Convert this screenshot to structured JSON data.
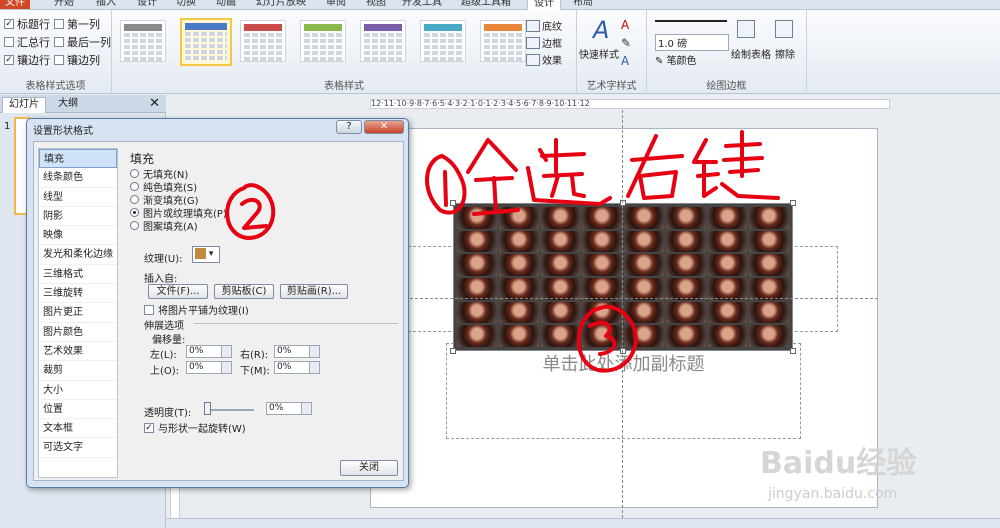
{
  "tabs": [
    "文件",
    "开始",
    "插入",
    "设计",
    "切换",
    "动画",
    "幻灯片放映",
    "审阅",
    "视图",
    "开发工具",
    "超级工具箱",
    "设计",
    "布局"
  ],
  "ribbon": {
    "style_options": {
      "items": [
        "标题行",
        "第一列",
        "汇总行",
        "最后一列",
        "镶边行",
        "镶边列"
      ],
      "checked": [
        true,
        false,
        false,
        false,
        true,
        false
      ],
      "label": "表格样式选项"
    },
    "table_styles": {
      "label": "表格样式",
      "swatch_colors": [
        "#8a8a8a",
        "#4a7bc4",
        "#c94b4b",
        "#8ab84a",
        "#7b5ea7",
        "#47a9c4",
        "#e8873a"
      ],
      "selected_index": 1
    },
    "shading": {
      "shading_label": "底纹",
      "border_label": "边框",
      "effects_label": "效果"
    },
    "art_text": {
      "quick_style_label": "快速样式",
      "group_label": "艺术字样式"
    },
    "draw_borders": {
      "weight": "1.0 磅",
      "pen_color_label": "笔颜色",
      "draw_table_label": "绘制表格",
      "eraser_label": "擦除",
      "group_label": "绘图边框"
    }
  },
  "left_panel": {
    "tab_slides": "幻灯片",
    "tab_outline": "大纲",
    "close": "✕",
    "slide_number": "1"
  },
  "ruler_text": "12·11·10·9·8·7·6·5·4·3·2·1·0·1·2·3·4·5·6·7·8·9·10·11·12",
  "vruler_text": "8",
  "slide": {
    "subtitle_placeholder": "单击此处添加副标题"
  },
  "dialog": {
    "title": "设置形状格式",
    "help_btn": "?",
    "close_btn": "✕",
    "categories": [
      "填充",
      "线条颜色",
      "线型",
      "阴影",
      "映像",
      "发光和柔化边缘",
      "三维格式",
      "三维旋转",
      "图片更正",
      "图片颜色",
      "艺术效果",
      "裁剪",
      "大小",
      "位置",
      "文本框",
      "可选文字"
    ],
    "selected_category": 0,
    "heading": "填充",
    "fill_options": [
      "无填充(N)",
      "纯色填充(S)",
      "渐变填充(G)",
      "图片或纹理填充(P)",
      "图案填充(A)"
    ],
    "selected_fill": 3,
    "texture_label": "纹理(U):",
    "insert_from_label": "插入自:",
    "btn_file": "文件(F)...",
    "btn_clipboard": "剪贴板(C)",
    "btn_clipart": "剪贴画(R)...",
    "tile_label": "将图片平铺为纹理(I)",
    "stretch_label": "伸展选项",
    "offset_label": "偏移量:",
    "left_label": "左(L):",
    "left_val": "0%",
    "right_label": "右(R):",
    "right_val": "0%",
    "top_label": "上(O):",
    "top_val": "0%",
    "bottom_label": "下(M):",
    "bottom_val": "0%",
    "transparency_label": "透明度(T):",
    "transparency_val": "0%",
    "rotate_label": "与形状一起旋转(W)",
    "close_label": "关闭"
  },
  "annotations": {
    "handwriting": "全选右键",
    "num1": "①",
    "num2": "②",
    "num3": "③"
  },
  "watermark": {
    "brand": "Baidu经验",
    "url": "jingyan.baidu.com"
  }
}
